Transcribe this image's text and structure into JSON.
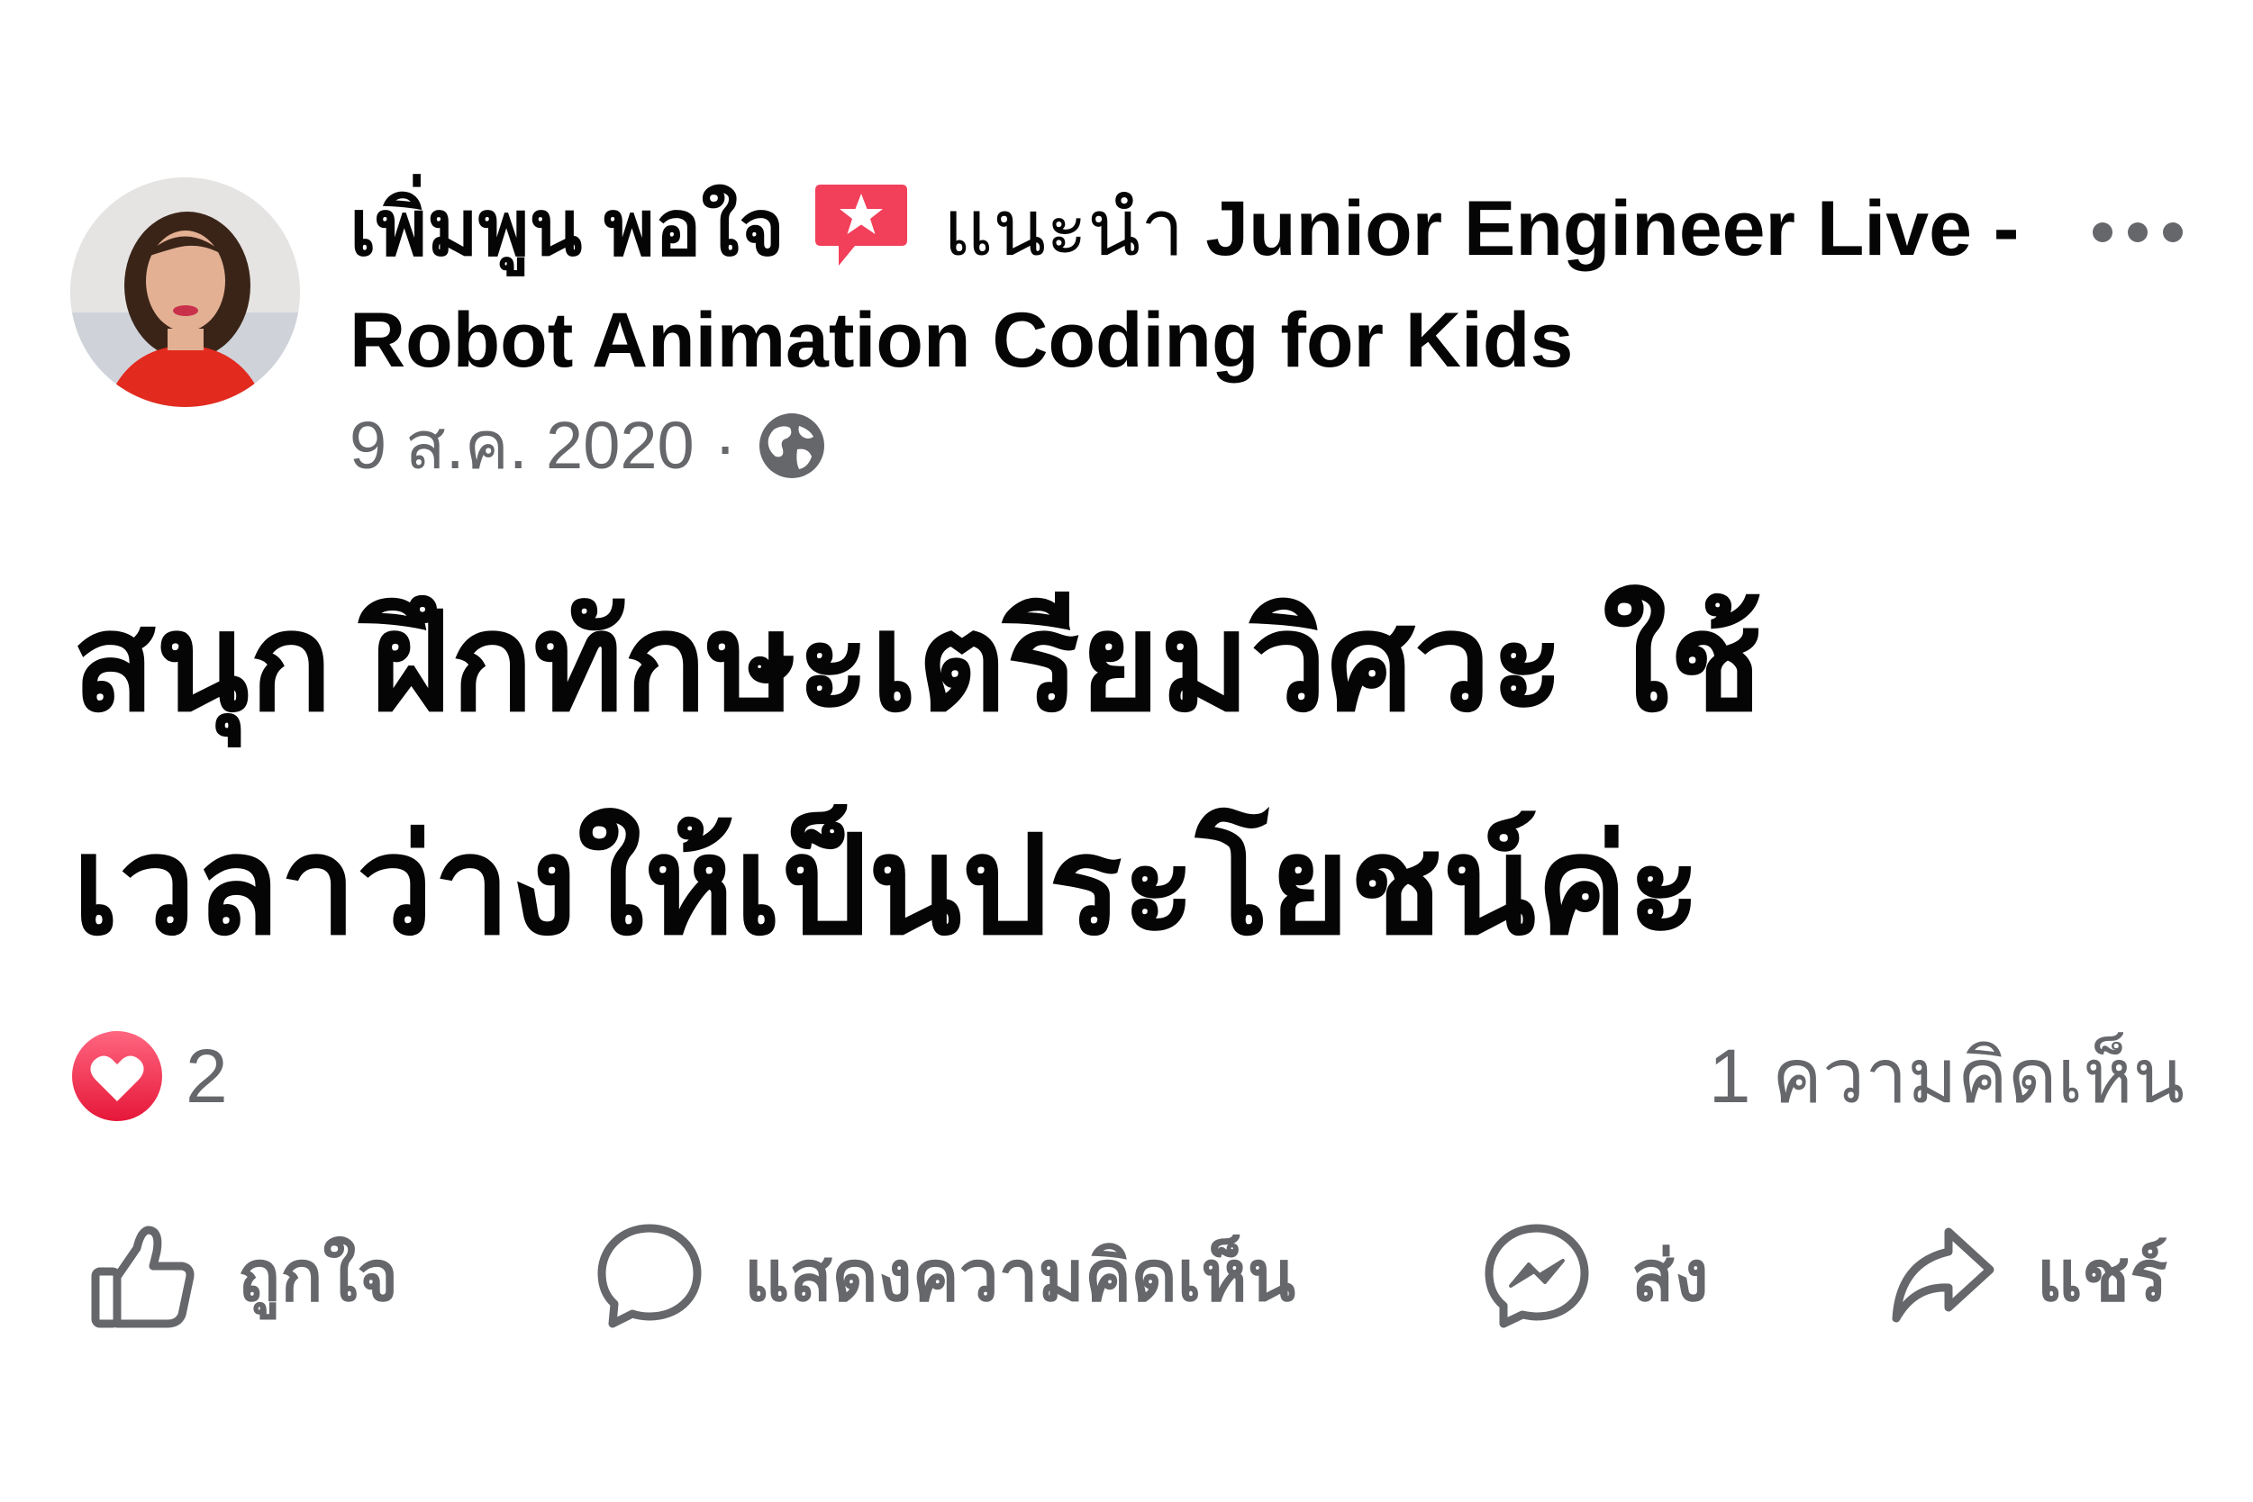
{
  "post": {
    "author": "เพิ่มพูน พอใจ",
    "action": "แนะนำ",
    "page_name": "Junior Engineer Live - Robot Animation Coding for Kids",
    "date": "9 ส.ค. 2020",
    "separator": "·",
    "audience_icon": "globe-icon",
    "badge_icon": "recommendation-star-icon",
    "body_line_1": "สนุก ฝึกทักษะเตรียมวิศวะ ใช้",
    "body_line_2": "เวลาว่างให้เป็นประโยชน์ค่ะ"
  },
  "stats": {
    "reaction_icon": "love-icon",
    "reaction_count": "2",
    "comment_count": "1 ความคิดเห็น"
  },
  "actions": {
    "like": "ถูกใจ",
    "comment": "แสดงความคิดเห็น",
    "send": "ส่ง",
    "share": "แชร์"
  },
  "colors": {
    "text_primary": "#050505",
    "text_secondary": "#65676b",
    "badge_red": "#f23f5a",
    "love_red": "#f33e58"
  }
}
